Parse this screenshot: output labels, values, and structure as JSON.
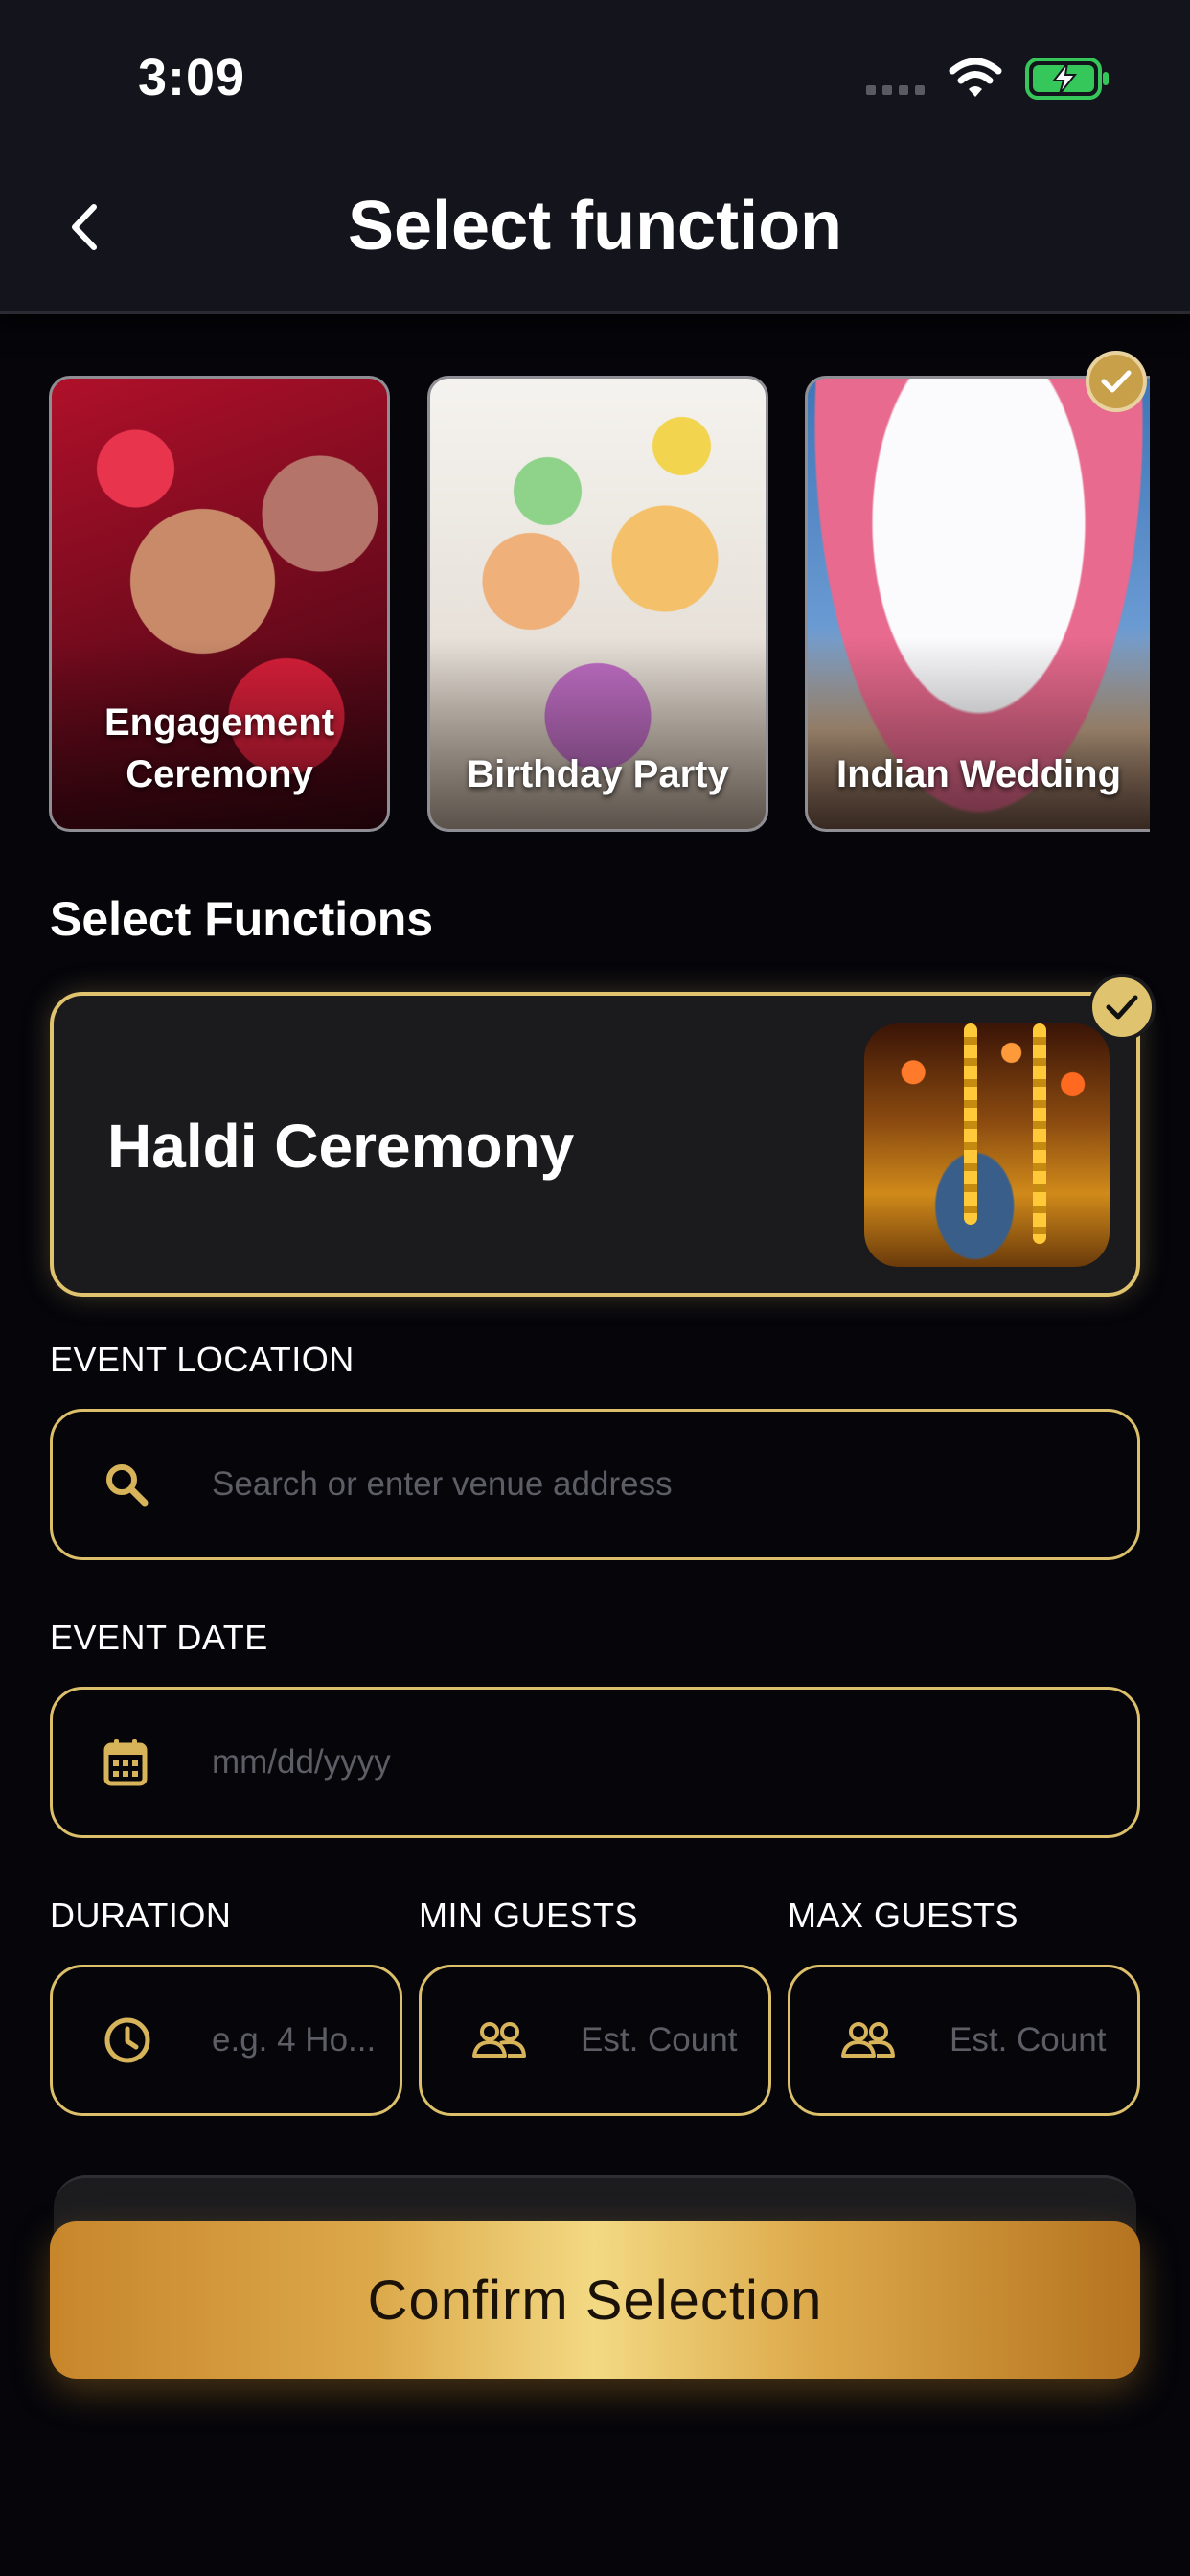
{
  "status_bar": {
    "time": "3:09"
  },
  "header": {
    "title": "Select function"
  },
  "categories": [
    {
      "label": "Engagement Ceremony",
      "selected": false
    },
    {
      "label": "Birthday Party",
      "selected": false
    },
    {
      "label": "Indian Wedding",
      "selected": true
    }
  ],
  "functions": {
    "section_title": "Select Functions",
    "selected_name": "Haldi Ceremony"
  },
  "form": {
    "location": {
      "label": "EVENT LOCATION",
      "placeholder": "Search or enter venue address",
      "icon": "search-icon"
    },
    "date": {
      "label": "EVENT DATE",
      "placeholder": "mm/dd/yyyy",
      "icon": "calendar-icon"
    },
    "duration": {
      "label": "DURATION",
      "placeholder": "e.g. 4 Ho...",
      "icon": "clock-icon"
    },
    "min_guests": {
      "label": "MIN GUESTS",
      "placeholder": "Est. Count",
      "icon": "people-icon"
    },
    "max_guests": {
      "label": "MAX GUESTS",
      "placeholder": "Est. Count",
      "icon": "people-icon"
    }
  },
  "actions": {
    "confirm_label": "Confirm Selection"
  },
  "colors": {
    "accent_gold": "#dcbf6a",
    "background": "#05050a",
    "header_bg": "#14141c",
    "battery_green": "#35c759"
  }
}
